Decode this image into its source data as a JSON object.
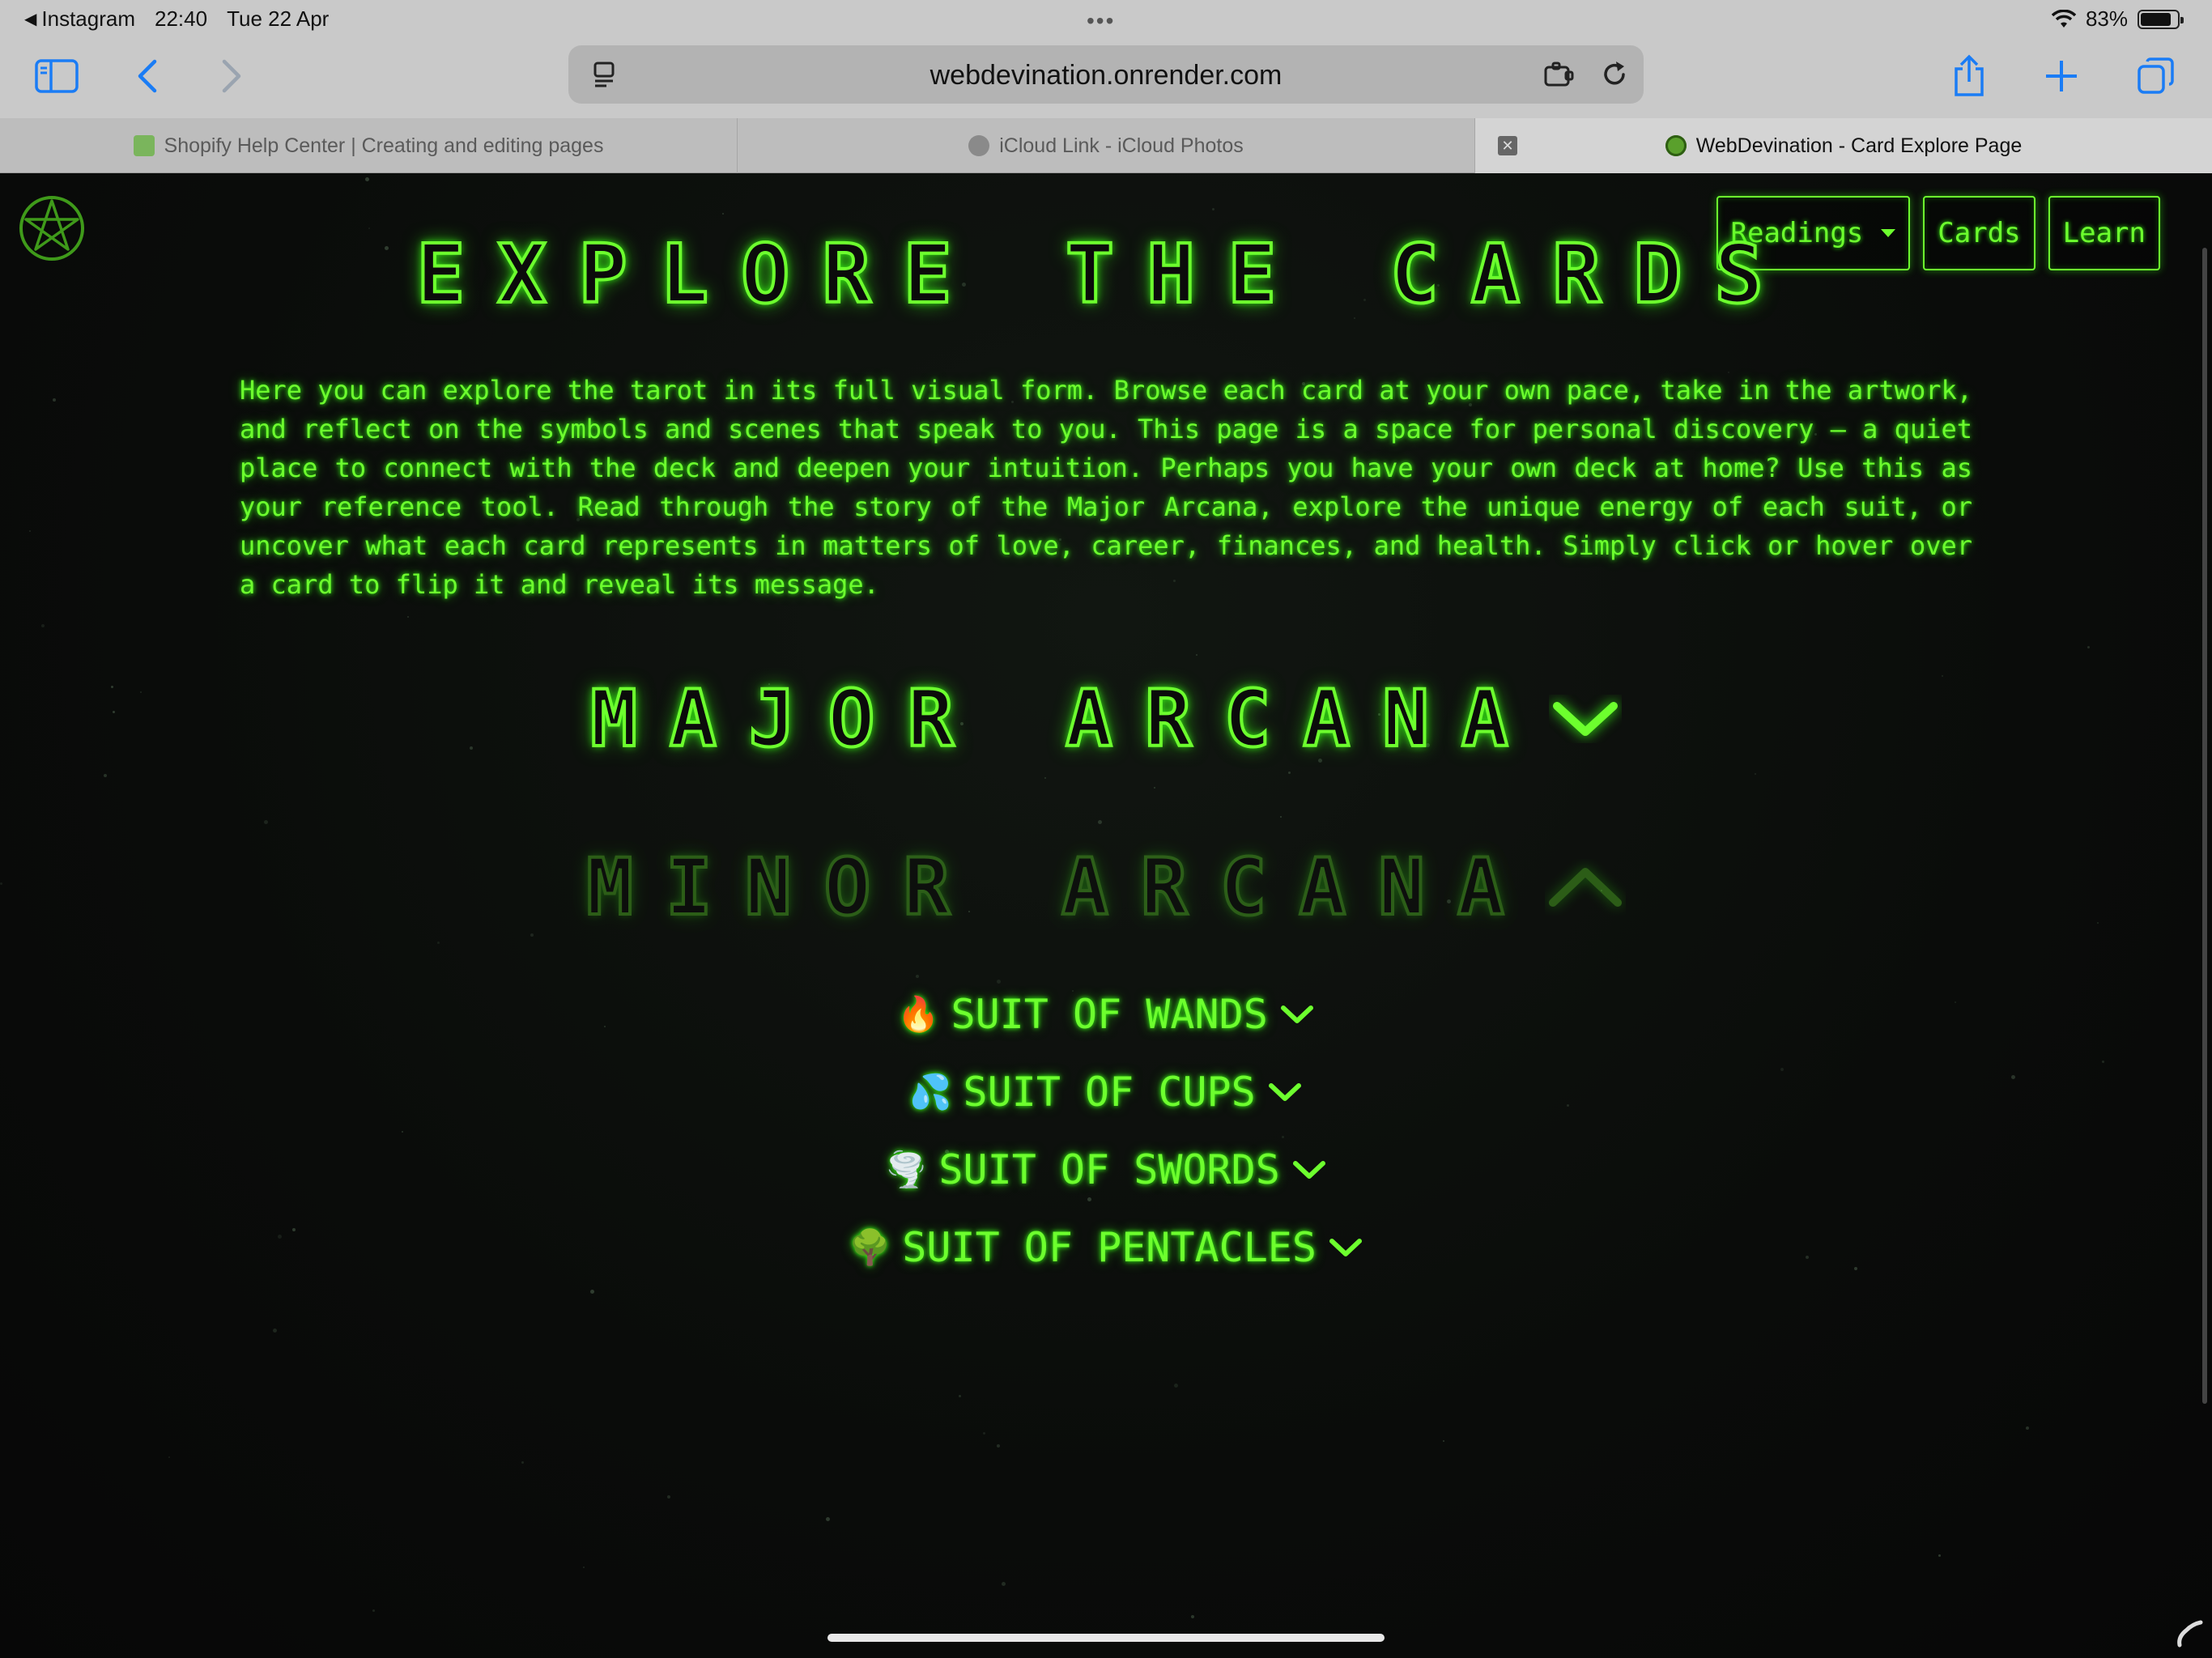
{
  "status": {
    "back_app": "Instagram",
    "time": "22:40",
    "date": "Tue 22 Apr",
    "battery": "83%",
    "battery_level": 0.83
  },
  "browser": {
    "url": "webdevination.onrender.com",
    "tabs": [
      {
        "label": "Shopify Help Center | Creating and editing pages",
        "favicon_color": "#7ab55c",
        "active": false
      },
      {
        "label": "iCloud Link - iCloud Photos",
        "favicon_color": "#8a8a8a",
        "active": false
      },
      {
        "label": "WebDevination - Card Explore Page",
        "favicon_color": "#5aa02c",
        "active": true
      }
    ],
    "tab_close_glyph": "✕"
  },
  "nav": {
    "readings_label": "Readings",
    "cards_label": "Cards",
    "learn_label": "Learn"
  },
  "page": {
    "title": "EXPLORE THE CARDS",
    "intro": "Here you can explore the tarot in its full visual form. Browse each card at your own pace, take in the artwork, and reflect on the symbols and scenes that speak to you. This page is a space for personal discovery — a quiet place to connect with the deck and deepen your intuition. Perhaps you have your own deck at home? Use this as your reference tool. Read through the story of the Major Arcana, explore the unique energy of each suit, or uncover what each card represents in matters of love, career, finances, and health. Simply click or hover over a card to flip it and reveal its message.",
    "major_heading": "MAJOR ARCANA",
    "minor_heading": "MINOR ARCANA",
    "suits": [
      {
        "emoji": "🔥",
        "label": "SUIT OF WANDS"
      },
      {
        "emoji": "💦",
        "label": "SUIT OF CUPS"
      },
      {
        "emoji": "🌪️",
        "label": "SUIT OF SWORDS"
      },
      {
        "emoji": "🌳",
        "label": "SUIT OF PENTACLES"
      }
    ]
  },
  "colors": {
    "neon": "#6dff2e",
    "background": "#0b0b0b",
    "chrome": "#c9c9c9"
  }
}
